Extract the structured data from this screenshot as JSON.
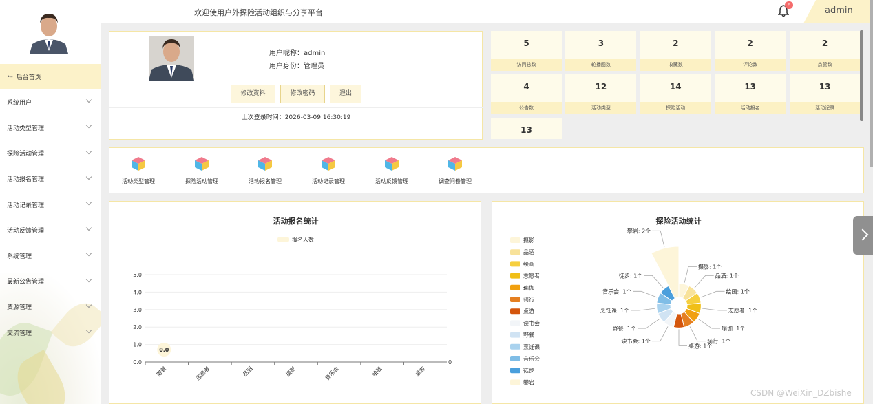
{
  "topbar": {
    "welcome": "欢迎使用户外探险活动组织与分享平台",
    "notification_count": "6",
    "user": "admin"
  },
  "sidebar": {
    "items": [
      {
        "label": "后台首页",
        "active": true
      },
      {
        "label": "系统用户"
      },
      {
        "label": "活动类型管理"
      },
      {
        "label": "探险活动管理"
      },
      {
        "label": "活动报名管理"
      },
      {
        "label": "活动记录管理"
      },
      {
        "label": "活动反馈管理"
      },
      {
        "label": "系统管理"
      },
      {
        "label": "最新公告管理"
      },
      {
        "label": "资源管理"
      },
      {
        "label": "交流管理"
      }
    ]
  },
  "profile": {
    "nickname_label": "用户昵称：",
    "nickname": "admin",
    "role_label": "用户身份：",
    "role": "管理员",
    "buttons": [
      "修改资料",
      "修改密码",
      "退出"
    ],
    "last_login": "上次登录时间：2026-03-09 16:30:19"
  },
  "stats": [
    {
      "value": "5",
      "label": "访问总数"
    },
    {
      "value": "3",
      "label": "轮播图数"
    },
    {
      "value": "2",
      "label": "收藏数"
    },
    {
      "value": "2",
      "label": "评论数"
    },
    {
      "value": "2",
      "label": "点赞数"
    },
    {
      "value": "4",
      "label": "公告数"
    },
    {
      "value": "12",
      "label": "活动类型"
    },
    {
      "value": "14",
      "label": "探险活动"
    },
    {
      "value": "13",
      "label": "活动报名"
    },
    {
      "value": "13",
      "label": "活动记录"
    },
    {
      "value": "13",
      "label": ""
    }
  ],
  "quick_links": [
    "活动类型管理",
    "探险活动管理",
    "活动报名管理",
    "活动记录管理",
    "活动反馈管理",
    "调查问卷管理"
  ],
  "icon_names": {
    "bell": "bell-icon",
    "cube": "cube-icon",
    "home": "home-icon",
    "chevron": "chevron-down-icon"
  },
  "colors": {
    "accent": "#fcf2c9",
    "border": "#f5e6a6",
    "badge": "#f56c6c"
  },
  "chart_data": [
    {
      "type": "bar",
      "title": "活动报名统计",
      "categories": [
        "野餐",
        "志愿者",
        "品酒",
        "摄影",
        "音乐会",
        "绘画",
        "桌游"
      ],
      "series": [
        {
          "name": "报名人数",
          "values": [
            0,
            0,
            0,
            0,
            0,
            0,
            0
          ]
        }
      ],
      "ylim": [
        0,
        5
      ],
      "yticks": [
        "0.0",
        "1.0",
        "2.0",
        "3.0",
        "4.0",
        "5.0"
      ],
      "data_labels": [
        "0.0"
      ],
      "right_axis_label": "0",
      "legend": "top"
    },
    {
      "type": "pie",
      "title": "探险活动统计",
      "legend": "left",
      "slices": [
        {
          "name": "摄影",
          "value": 1,
          "label": "摄影: 1个",
          "color": "#fdf5d9"
        },
        {
          "name": "品酒",
          "value": 1,
          "label": "品酒: 1个",
          "color": "#f8e29a"
        },
        {
          "name": "绘画",
          "value": 1,
          "label": "绘画: 1个",
          "color": "#f6cf3e"
        },
        {
          "name": "志愿者",
          "value": 1,
          "label": "志愿者: 1个",
          "color": "#f0bf17"
        },
        {
          "name": "瑜伽",
          "value": 1,
          "label": "瑜伽: 1个",
          "color": "#f1a00f"
        },
        {
          "name": "骑行",
          "value": 1,
          "label": "骑行: 1个",
          "color": "#e57f21"
        },
        {
          "name": "桌游",
          "value": 1,
          "label": "桌游: 1个",
          "color": "#d4560d"
        },
        {
          "name": "读书会",
          "value": 1,
          "label": "读书会: 1个",
          "color": "#f2f5f8"
        },
        {
          "name": "野餐",
          "value": 1,
          "label": "野餐: 1个",
          "color": "#d0e3f3"
        },
        {
          "name": "烹饪课",
          "value": 1,
          "label": "烹饪课: 1个",
          "color": "#a9d2ee"
        },
        {
          "name": "音乐会",
          "value": 1,
          "label": "音乐会: 1个",
          "color": "#7fbde6"
        },
        {
          "name": "徒步",
          "value": 1,
          "label": "徒步: 1个",
          "color": "#4a9fdc"
        },
        {
          "name": "攀岩",
          "value": 2,
          "label": "攀岩: 2个",
          "color": "#fdf5d9"
        }
      ]
    }
  ],
  "watermark": "CSDN @WeiXin_DZbishe"
}
